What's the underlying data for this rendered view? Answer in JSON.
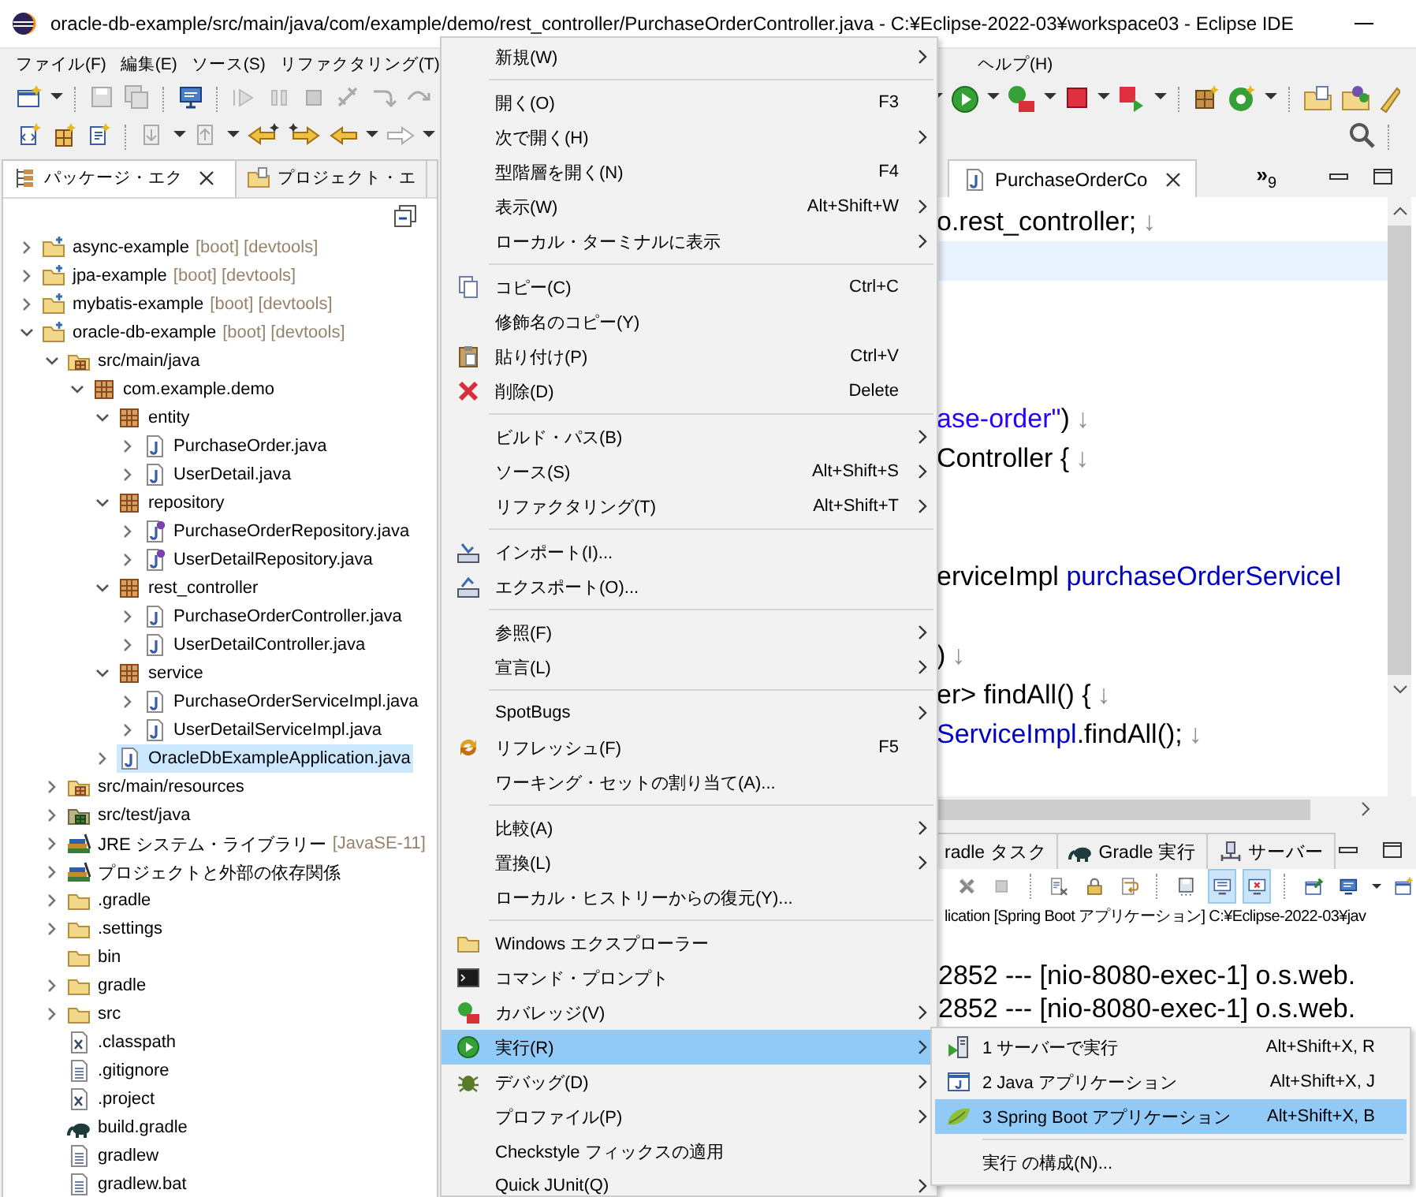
{
  "window": {
    "title": "oracle-db-example/src/main/java/com/example/demo/rest_controller/PurchaseOrderController.java - C:¥Eclipse-2022-03¥workspace03 - Eclipse IDE"
  },
  "menu_bar_left": [
    {
      "label": "ファイル(F)"
    },
    {
      "label": "編集(E)"
    },
    {
      "label": "ソース(S)"
    },
    {
      "label": "リファクタリング(T)"
    }
  ],
  "menu_bar_right": [
    {
      "label": "ヘルプ(H)"
    }
  ],
  "left_panel": {
    "tabs": [
      {
        "label": "パッケージ・エク",
        "selected": true,
        "closable": true,
        "kind": "package"
      },
      {
        "label": "プロジェクト・エ",
        "selected": false,
        "closable": false,
        "kind": "project"
      }
    ],
    "tree": [
      {
        "label": "async-example",
        "decoration": "[boot] [devtools]",
        "kind": "project",
        "expanded": false,
        "selected": false
      },
      {
        "label": "jpa-example",
        "decoration": "[boot] [devtools]",
        "kind": "project",
        "expanded": false,
        "selected": false
      },
      {
        "label": "mybatis-example",
        "decoration": "[boot] [devtools]",
        "kind": "project",
        "expanded": false,
        "selected": false
      },
      {
        "label": "oracle-db-example",
        "decoration": "[boot] [devtools]",
        "kind": "project",
        "expanded": true,
        "selected": false,
        "children": [
          {
            "label": "src/main/java",
            "kind": "srcfolder",
            "expanded": true,
            "selected": false,
            "children": [
              {
                "label": "com.example.demo",
                "kind": "package",
                "expanded": true,
                "selected": false,
                "children": [
                  {
                    "label": "entity",
                    "kind": "package",
                    "expanded": true,
                    "selected": false,
                    "children": [
                      {
                        "label": "PurchaseOrder.java",
                        "kind": "java",
                        "expanded": false,
                        "selected": false
                      },
                      {
                        "label": "UserDetail.java",
                        "kind": "java",
                        "expanded": false,
                        "selected": false
                      }
                    ]
                  },
                  {
                    "label": "repository",
                    "kind": "package",
                    "expanded": true,
                    "selected": false,
                    "children": [
                      {
                        "label": "PurchaseOrderRepository.java",
                        "kind": "interface",
                        "expanded": false,
                        "selected": false
                      },
                      {
                        "label": "UserDetailRepository.java",
                        "kind": "interface",
                        "expanded": false,
                        "selected": false
                      }
                    ]
                  },
                  {
                    "label": "rest_controller",
                    "kind": "package",
                    "expanded": true,
                    "selected": false,
                    "children": [
                      {
                        "label": "PurchaseOrderController.java",
                        "kind": "java",
                        "expanded": false,
                        "selected": false
                      },
                      {
                        "label": "UserDetailController.java",
                        "kind": "java",
                        "expanded": false,
                        "selected": false
                      }
                    ]
                  },
                  {
                    "label": "service",
                    "kind": "package",
                    "expanded": true,
                    "selected": false,
                    "children": [
                      {
                        "label": "PurchaseOrderServiceImpl.java",
                        "kind": "java",
                        "expanded": false,
                        "selected": false
                      },
                      {
                        "label": "UserDetailServiceImpl.java",
                        "kind": "java",
                        "expanded": false,
                        "selected": false
                      }
                    ]
                  },
                  {
                    "label": "OracleDbExampleApplication.java",
                    "kind": "java",
                    "expanded": false,
                    "selected": true
                  }
                ]
              }
            ]
          },
          {
            "label": "src/main/resources",
            "kind": "srcfolder",
            "expanded": false,
            "selected": false
          },
          {
            "label": "src/test/java",
            "kind": "testfolder",
            "expanded": false,
            "selected": false
          },
          {
            "label": "JRE システム・ライブラリー",
            "decoration": "[JavaSE-11]",
            "kind": "library",
            "expanded": false,
            "selected": false
          },
          {
            "label": "プロジェクトと外部の依存関係",
            "kind": "library",
            "expanded": false,
            "selected": false
          },
          {
            "label": ".gradle",
            "kind": "folder",
            "expanded": false,
            "selected": false
          },
          {
            "label": ".settings",
            "kind": "folder",
            "expanded": false,
            "selected": false
          },
          {
            "label": "bin",
            "kind": "folder",
            "selected": false
          },
          {
            "label": "gradle",
            "kind": "folder",
            "expanded": false,
            "selected": false
          },
          {
            "label": "src",
            "kind": "folder",
            "expanded": false,
            "selected": false
          },
          {
            "label": ".classpath",
            "kind": "xml",
            "selected": false
          },
          {
            "label": ".gitignore",
            "kind": "text",
            "selected": false
          },
          {
            "label": ".project",
            "kind": "xml",
            "selected": false
          },
          {
            "label": "build.gradle",
            "kind": "gradle",
            "selected": false
          },
          {
            "label": "gradlew",
            "kind": "text",
            "selected": false
          },
          {
            "label": "gradlew.bat",
            "kind": "text",
            "selected": false
          }
        ]
      }
    ]
  },
  "editor": {
    "tabs": [
      {
        "label": "PurchaseOrderCo",
        "selected": true
      }
    ],
    "overflow": {
      "label": "»",
      "count": "9"
    },
    "lines": [
      {
        "kind": "code",
        "segments": [
          {
            "kind": "plain",
            "text": "o.rest_controller;"
          },
          {
            "kind": "eol",
            "text": "↓"
          }
        ]
      },
      {
        "kind": "current"
      },
      {
        "kind": "blank"
      },
      {
        "kind": "blank"
      },
      {
        "kind": "blank"
      },
      {
        "kind": "code",
        "segments": [
          {
            "kind": "string",
            "text": "ase-order\""
          },
          {
            "kind": "plain",
            "text": ")"
          },
          {
            "kind": "eol",
            "text": "↓"
          }
        ]
      },
      {
        "kind": "code",
        "segments": [
          {
            "kind": "plain",
            "text": "Controller {"
          },
          {
            "kind": "eol",
            "text": "↓"
          }
        ]
      },
      {
        "kind": "blank"
      },
      {
        "kind": "blank"
      },
      {
        "kind": "code",
        "segments": [
          {
            "kind": "plain",
            "text": "erviceImpl "
          },
          {
            "kind": "field",
            "text": "purchaseOrderServiceI"
          }
        ]
      },
      {
        "kind": "blank"
      },
      {
        "kind": "code",
        "segments": [
          {
            "kind": "plain",
            "text": ")"
          },
          {
            "kind": "eol",
            "text": "↓"
          }
        ]
      },
      {
        "kind": "code",
        "segments": [
          {
            "kind": "plain",
            "text": "er> findAll() {"
          },
          {
            "kind": "eol",
            "text": "↓"
          }
        ]
      },
      {
        "kind": "code",
        "segments": [
          {
            "kind": "field",
            "text": "ServiceImpl"
          },
          {
            "kind": "plain",
            "text": ".findAll();"
          },
          {
            "kind": "eol",
            "text": "↓"
          }
        ]
      },
      {
        "kind": "blank"
      }
    ]
  },
  "console": {
    "tabs": [
      {
        "label": "radle タスク",
        "kind": "plain"
      },
      {
        "label": "Gradle 実行",
        "kind": "gradle"
      },
      {
        "label": "サーバー",
        "kind": "server"
      }
    ],
    "toolbar": [
      [
        {
          "kind": "remove",
          "pressed": false
        },
        {
          "kind": "terminate",
          "pressed": false
        }
      ],
      [
        {
          "kind": "clear",
          "pressed": false
        },
        {
          "kind": "lock",
          "pressed": false
        },
        {
          "kind": "wrap",
          "pressed": false
        }
      ],
      [
        {
          "kind": "save",
          "pressed": false
        },
        {
          "kind": "out",
          "pressed": true
        },
        {
          "kind": "err",
          "pressed": true
        }
      ],
      [
        {
          "kind": "pin",
          "pressed": false
        },
        {
          "kind": "display",
          "pressed": false
        },
        {
          "kind": "new",
          "pressed": false
        }
      ]
    ],
    "header": "lication [Spring Boot アプリケーション] C:¥Eclipse-2022-03¥jav",
    "lines": [
      "2852 --- [nio-8080-exec-1] o.s.web.",
      "2852 --- [nio-8080-exec-1] o.s.web."
    ]
  },
  "context_menu": {
    "items": [
      {
        "kind": "item",
        "label": "新規(W)",
        "submenu": true,
        "selected": false
      },
      {
        "kind": "separator"
      },
      {
        "kind": "item",
        "label": "開く(O)",
        "shortcut": "F3",
        "submenu": false,
        "selected": false
      },
      {
        "kind": "item",
        "label": "次で開く(H)",
        "submenu": true,
        "selected": false
      },
      {
        "kind": "item",
        "label": "型階層を開く(N)",
        "shortcut": "F4",
        "submenu": false,
        "selected": false
      },
      {
        "kind": "item",
        "label": "表示(W)",
        "shortcut": "Alt+Shift+W",
        "submenu": true,
        "selected": false
      },
      {
        "kind": "item",
        "label": "ローカル・ターミナルに表示",
        "submenu": true,
        "selected": false
      },
      {
        "kind": "separator"
      },
      {
        "kind": "copy",
        "label": "コピー(C)",
        "shortcut": "Ctrl+C",
        "submenu": false,
        "selected": false
      },
      {
        "kind": "item",
        "label": "修飾名のコピー(Y)",
        "submenu": false,
        "selected": false
      },
      {
        "kind": "paste",
        "label": "貼り付け(P)",
        "shortcut": "Ctrl+V",
        "submenu": false,
        "selected": false
      },
      {
        "kind": "delete",
        "label": "削除(D)",
        "shortcut": "Delete",
        "submenu": false,
        "selected": false
      },
      {
        "kind": "separator"
      },
      {
        "kind": "item",
        "label": "ビルド・パス(B)",
        "submenu": true,
        "selected": false
      },
      {
        "kind": "item",
        "label": "ソース(S)",
        "shortcut": "Alt+Shift+S",
        "submenu": true,
        "selected": false
      },
      {
        "kind": "item",
        "label": "リファクタリング(T)",
        "shortcut": "Alt+Shift+T",
        "submenu": true,
        "selected": false
      },
      {
        "kind": "separator"
      },
      {
        "kind": "import",
        "label": "インポート(I)...",
        "submenu": false,
        "selected": false
      },
      {
        "kind": "export",
        "label": "エクスポート(O)...",
        "submenu": false,
        "selected": false
      },
      {
        "kind": "separator"
      },
      {
        "kind": "item",
        "label": "参照(F)",
        "submenu": true,
        "selected": false
      },
      {
        "kind": "item",
        "label": "宣言(L)",
        "submenu": true,
        "selected": false
      },
      {
        "kind": "separator"
      },
      {
        "kind": "item",
        "label": "SpotBugs",
        "submenu": true,
        "selected": false
      },
      {
        "kind": "refresh",
        "label": "リフレッシュ(F)",
        "shortcut": "F5",
        "submenu": false,
        "selected": false
      },
      {
        "kind": "item",
        "label": "ワーキング・セットの割り当て(A)...",
        "submenu": false,
        "selected": false
      },
      {
        "kind": "separator"
      },
      {
        "kind": "item",
        "label": "比較(A)",
        "submenu": true,
        "selected": false
      },
      {
        "kind": "item",
        "label": "置換(L)",
        "submenu": true,
        "selected": false
      },
      {
        "kind": "item",
        "label": "ローカル・ヒストリーからの復元(Y)...",
        "submenu": false,
        "selected": false
      },
      {
        "kind": "separator"
      },
      {
        "kind": "explorer",
        "label": "Windows エクスプローラー",
        "submenu": false,
        "selected": false
      },
      {
        "kind": "terminal",
        "label": "コマンド・プロンプト",
        "submenu": false,
        "selected": false
      },
      {
        "kind": "coverage",
        "label": "カバレッジ(V)",
        "submenu": true,
        "selected": false
      },
      {
        "kind": "run",
        "label": "実行(R)",
        "submenu": true,
        "selected": true
      },
      {
        "kind": "debug",
        "label": "デバッグ(D)",
        "submenu": true,
        "selected": false
      },
      {
        "kind": "item",
        "label": "プロファイル(P)",
        "submenu": true,
        "selected": false
      },
      {
        "kind": "item",
        "label": "Checkstyle フィックスの適用",
        "submenu": false,
        "selected": false
      },
      {
        "kind": "item",
        "label": "Quick JUnit(Q)",
        "submenu": true,
        "selected": false
      }
    ]
  },
  "submenu": {
    "items": [
      {
        "kind": "server",
        "label": "1 サーバーで実行",
        "shortcut": "Alt+Shift+X, R",
        "selected": false
      },
      {
        "kind": "javaapp",
        "label": "2 Java アプリケーション",
        "shortcut": "Alt+Shift+X, J",
        "selected": false
      },
      {
        "kind": "leaf",
        "label": "3 Spring Boot アプリケーション",
        "shortcut": "Alt+Shift+X, B",
        "selected": true
      },
      {
        "kind": "separator"
      },
      {
        "kind": "item",
        "label": "実行 の構成(N)...",
        "selected": false
      }
    ]
  }
}
